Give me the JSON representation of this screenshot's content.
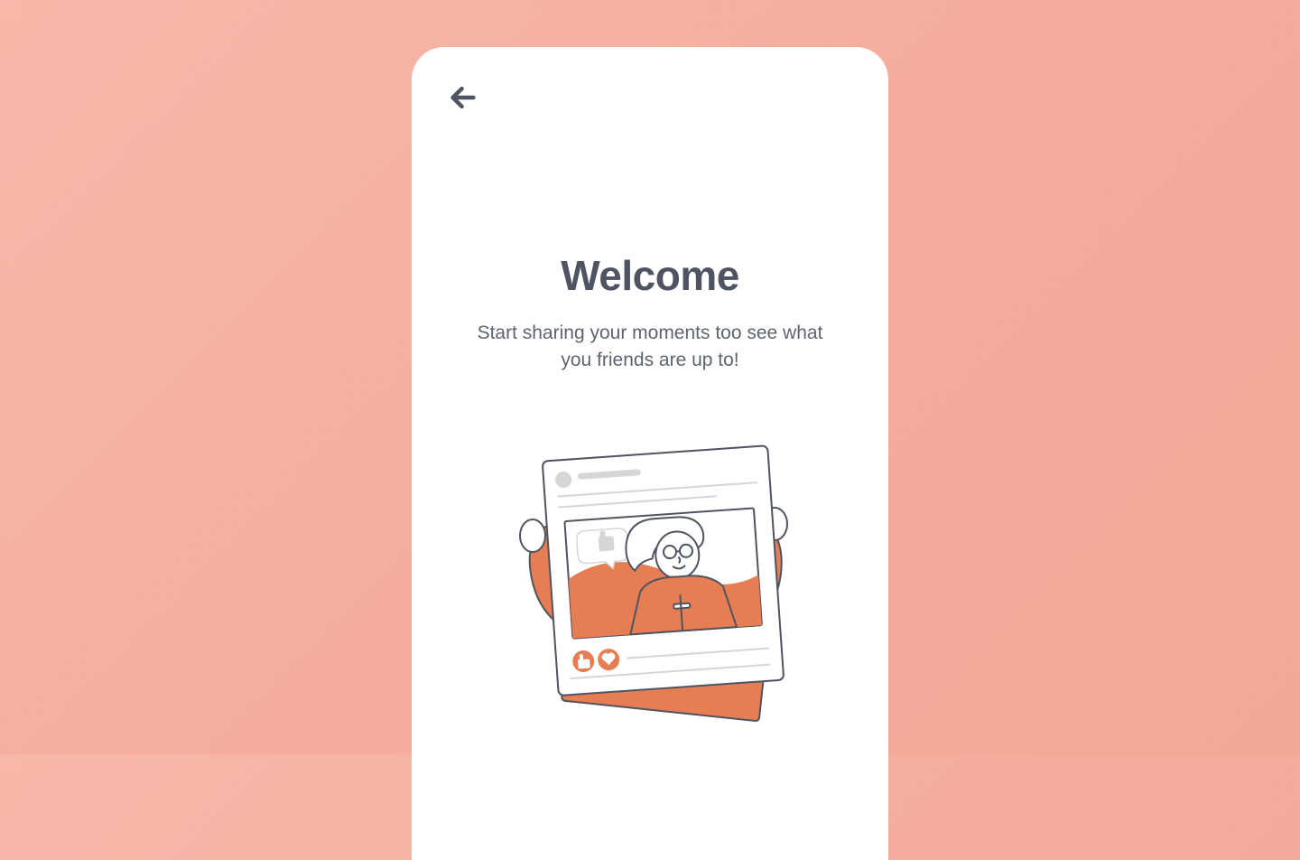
{
  "nav": {
    "back_icon": "arrow-left"
  },
  "main": {
    "title": "Welcome",
    "subtitle": "Start sharing your moments too see what you friends are up to!"
  },
  "colors": {
    "bg_peach": "#f5ac9d",
    "text_dark": "#4e5462",
    "accent_orange": "#e77d53"
  }
}
